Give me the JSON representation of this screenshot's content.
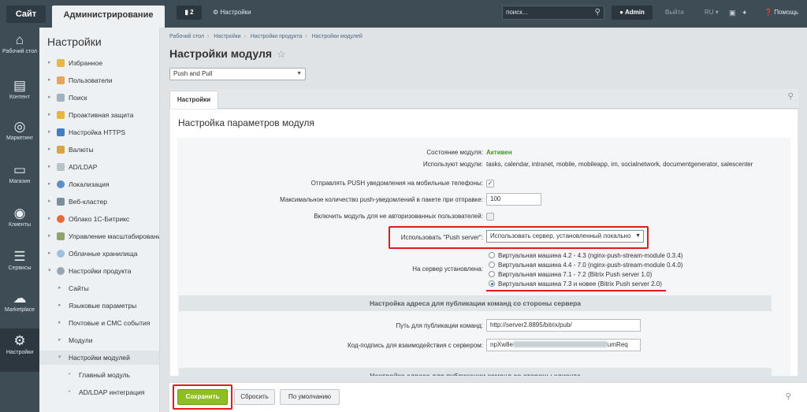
{
  "topbar": {
    "site": "Сайт",
    "admin": "Администрирование",
    "notif_count": "2",
    "settings": "Настройки",
    "search_placeholder": "поиск...",
    "user": "Admin",
    "logout": "Выйти",
    "lang": "RU",
    "help": "Помощь"
  },
  "iconbar": [
    {
      "label": "Рабочий стол",
      "icon": "home-icon"
    },
    {
      "label": "Контент",
      "icon": "document-icon"
    },
    {
      "label": "Маркетинг",
      "icon": "target-icon"
    },
    {
      "label": "Магазин",
      "icon": "basket-icon"
    },
    {
      "label": "Клиенты",
      "icon": "clients-icon"
    },
    {
      "label": "Сервисы",
      "icon": "layers-icon"
    },
    {
      "label": "Marketplace",
      "icon": "cloud-download-icon"
    },
    {
      "label": "Настройки",
      "icon": "gear-icon"
    }
  ],
  "leftmenu": {
    "title": "Настройки",
    "items": [
      "Избранное",
      "Пользователи",
      "Поиск",
      "Проактивная защита",
      "Настройка HTTPS",
      "Валюты",
      "AD/LDAP",
      "Локализация",
      "Веб-кластер",
      "Облако 1С-Битрикс",
      "Управление масштабированием",
      "Облачные хранилища",
      "Настройки продукта",
      "Сайты",
      "Языковые параметры",
      "Почтовые и СМС события",
      "Модули",
      "Настройки модулей",
      "Главный модуль",
      "AD/LDAP интеграция"
    ]
  },
  "breadcrumbs": [
    "Рабочий стол",
    "Настройки",
    "Настройки продукта",
    "Настройки модулей"
  ],
  "page_title": "Настройки модуля",
  "module_select": "Push and Pull",
  "tab": "Настройки",
  "panel_title": "Настройка параметров модуля",
  "form": {
    "state_label": "Состояние модуля:",
    "state_value": "Активен",
    "used_label": "Используют модули:",
    "used_value": "tasks, calendar, intranet, mobile, mobileapp, im, socialnetwork, documentgenerator, salescenter",
    "push_label": "Отправлять PUSH уведомления на мобильные телефоны:",
    "max_label": "Максимальное количество push-уведомлений в пакете при отправке:",
    "max_value": "100",
    "guest_label": "Включить модуль для не авторизованных пользователей:",
    "server_label": "Использовать \"Push server\":",
    "server_value": "Использовать сервер, установленный локально",
    "installed_label": "На сервер установлена:",
    "radios": [
      "Виртуальная машина 4.2 - 4.3 (nginx-push-stream-module 0.3.4)",
      "Виртуальная машина 4.4 - 7.0 (nginx-push-stream-module 0.4.0)",
      "Виртуальная машина 7.1 - 7.2 (Bitrix Push server 1.0)",
      "Виртуальная машина 7.3 и новее (Bitrix Push server 2.0)"
    ],
    "section_server": "Настройка адреса для публикации команд со стороны сервера",
    "pub_path_label": "Путь для публикации команд:",
    "pub_path_value": "http://server2.8895/bitrix/pub/",
    "sign_label": "Код-подпись для взаимодействия с сервером:",
    "sign_prefix": "npXw8e",
    "sign_suffix": "umReq",
    "section_client": "Настройка адреса для публикации команд со стороны клиента"
  },
  "buttons": {
    "save": "Сохранить",
    "reset": "Сбросить",
    "default": "По умолчанию"
  },
  "colors": {
    "accent_red": "#e11a1a",
    "save_green": "#8fbf1f",
    "active_green": "#3b9a1a"
  }
}
